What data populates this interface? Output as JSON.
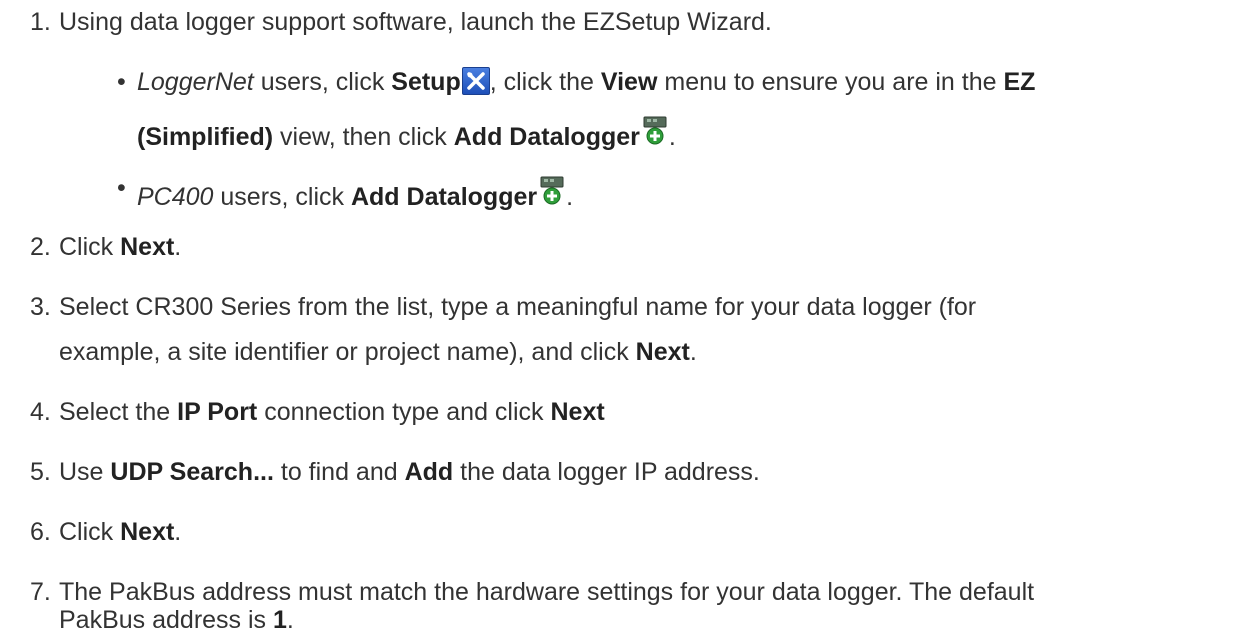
{
  "steps": [
    {
      "num": "1.",
      "before": "Using data logger support software, launch the EZSetup Wizard."
    },
    {
      "num": "2.",
      "before": "Click ",
      "bold1": "Next",
      "after": "."
    },
    {
      "num": "3.",
      "line1": "Select CR300 Series from the list, type a meaningful name for your data logger (for",
      "line2_before": "example, a site identifier or project name), and click ",
      "line2_bold": "Next",
      "line2_after": "."
    },
    {
      "num": "4.",
      "before": "Select the ",
      "bold1": "IP Port",
      "mid": " connection type and click ",
      "bold2": "Next"
    },
    {
      "num": "5.",
      "before": "Use ",
      "bold1": "UDP Search...",
      "mid": " to find and ",
      "bold2": "Add",
      "after": " the data logger IP address."
    },
    {
      "num": "6.",
      "before": "Click ",
      "bold1": "Next",
      "after": "."
    },
    {
      "num": "7.",
      "line1": "The PakBus address must match the hardware settings for your data logger. The default",
      "line2_before": "PakBus address is ",
      "line2_bold": "1",
      "line2_after": "."
    }
  ],
  "bullets": [
    {
      "italic": "LoggerNet",
      "t1": " users, click ",
      "b1": "Setup",
      "t2": ", click the ",
      "b2": "View",
      "t3": " menu to ensure you are in the ",
      "b3": "EZ",
      "line2_bold": "(Simplified)",
      "t4": " view, then click ",
      "b4": "Add Datalogger",
      "t5": "."
    },
    {
      "italic": "PC400",
      "t1": " users, click ",
      "b1": "Add Datalogger",
      "t2": "."
    }
  ],
  "icons": {
    "setup": "setup-tools-icon",
    "add_datalogger": "add-datalogger-icon"
  }
}
